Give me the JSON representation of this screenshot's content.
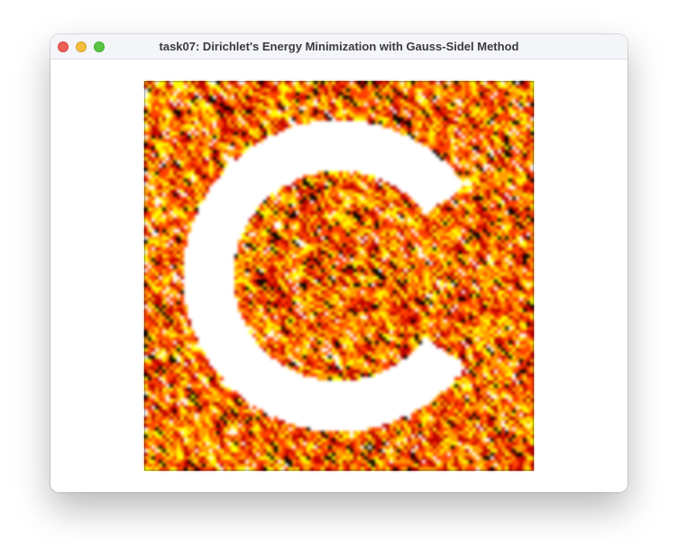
{
  "window": {
    "title": "task07: Dirichlet's Energy Minimization with Gauss-Sidel Method",
    "controls": {
      "close_icon": "close-dot-icon",
      "minimize_icon": "minimize-dot-icon",
      "zoom_icon": "zoom-dot-icon",
      "close_color": "#ee5f57",
      "minimize_color": "#f5bd3b",
      "zoom_color": "#5cc644"
    }
  },
  "viewport": {
    "description_colormap": [
      "#000000",
      "#c00000",
      "#ff4000",
      "#ffa000",
      "#ffff00",
      "#ffffff"
    ],
    "background": "#000000"
  }
}
